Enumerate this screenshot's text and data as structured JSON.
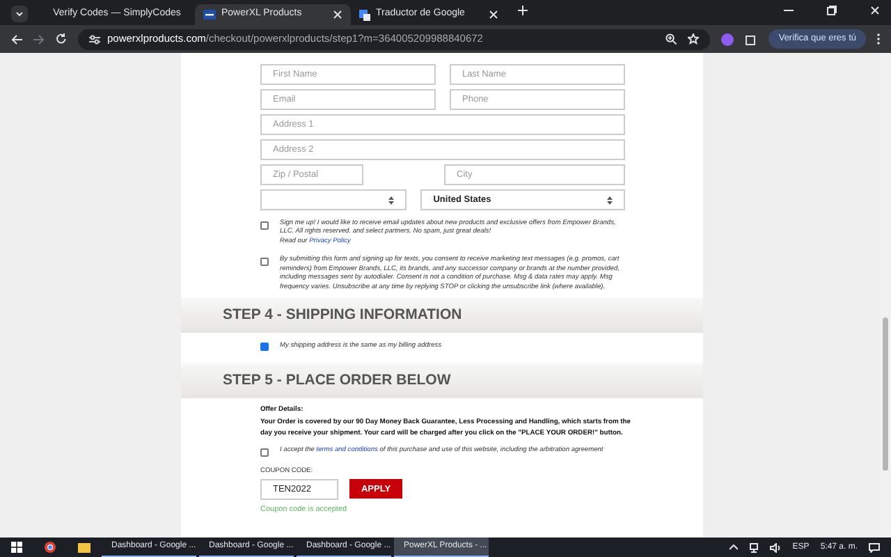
{
  "browser": {
    "tabs": [
      {
        "title": "Verify Codes — SimplyCodes",
        "selected": false
      },
      {
        "title": "PowerXL Products",
        "selected": true
      },
      {
        "title": "Traductor de Google",
        "selected": false
      }
    ],
    "url_host": "powerxlproducts.com",
    "url_path": "/checkout/powerxlproducts/step1?m=364005209988840672",
    "profile_button": "Verifica que eres tú"
  },
  "form": {
    "rows": [
      [
        {
          "kind": "input",
          "placeholder": "First Name"
        },
        {
          "kind": "input",
          "placeholder": "Last Name"
        }
      ],
      [
        {
          "kind": "input",
          "placeholder": "Email"
        },
        {
          "kind": "input",
          "placeholder": "Phone"
        }
      ],
      [
        {
          "kind": "input",
          "placeholder": "Address 1"
        }
      ],
      [
        {
          "kind": "input",
          "placeholder": "Address 2"
        }
      ],
      [
        {
          "kind": "short-input",
          "placeholder": "Zip / Postal"
        },
        {
          "kind": "input",
          "placeholder": "City"
        }
      ],
      [
        {
          "kind": "select"
        },
        {
          "kind": "select",
          "value": "United States"
        }
      ]
    ],
    "consents": [
      {
        "checked": false,
        "text": "Sign me up! I would like to receive email updates about new products and exclusive offers from Empower Brands, LLC. All rights reserved. and select partners. No spam, just great deals!",
        "after_break": "Read our ",
        "link": "Privacy Policy"
      },
      {
        "checked": false,
        "text": "By submitting this form and signing up for texts, you consent to receive marketing text messages (e.g. promos, cart reminders) from Empower Brands, LLC, its brands, and any successor company or brands at the number provided, including messages sent by autodialer. Consent is not a condition of purchase. Msg & data rates may apply. Msg frequency varies. Unsubscribe at any time by replying STOP or clicking the unsubscribe link (where available)."
      }
    ]
  },
  "step4": {
    "heading": "STEP 4 - SHIPPING INFORMATION",
    "same_address": {
      "checked": true,
      "label": "My shipping address is the same as my billing address"
    }
  },
  "step5": {
    "heading": "STEP 5 - PLACE ORDER BELOW",
    "offer_title": "Offer Details:",
    "offer_text": "Your Order is covered by our 90 Day Money Back Guarantee, Less Processing and Handling, which starts from the day you receive your shipment. Your card will be charged after you click on the \"PLACE YOUR ORDER!\" button.",
    "terms": {
      "checked": false,
      "before": "I accept the ",
      "link": "terms and conditions",
      "after": " of this purchase and use of this website, including the arbitration agreement"
    },
    "coupon_label": "COUPON CODE:",
    "coupon_value": "TEN2022",
    "apply_button": "APPLY",
    "coupon_status": "Coupon code is accepted"
  },
  "taskbar": {
    "items": [
      {
        "label": "Dashboard - Google ...",
        "selected": false
      },
      {
        "label": "Dashboard - Google ...",
        "selected": false
      },
      {
        "label": "Dashboard - Google ...",
        "selected": false
      },
      {
        "label": "PowerXL Products - ...",
        "selected": true
      }
    ],
    "language": "ESP",
    "time": "5:47 a. m."
  }
}
